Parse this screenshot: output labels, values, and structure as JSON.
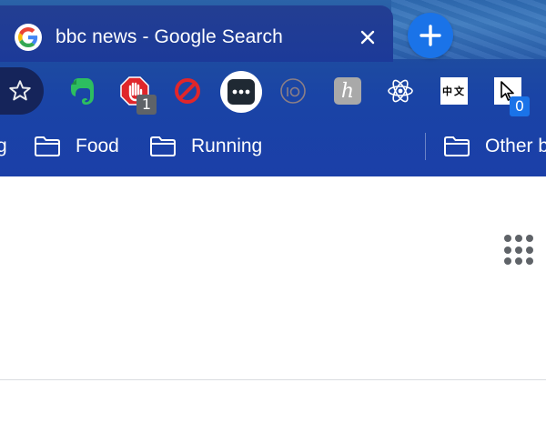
{
  "tab": {
    "title": "bbc news - Google Search",
    "favicon_icon": "google-g-icon",
    "close_icon": "close-icon"
  },
  "new_tab": {
    "icon": "plus-icon"
  },
  "toolbar": {
    "bookmark_star_icon": "star-outline-icon",
    "extensions": [
      {
        "name": "evernote",
        "icon": "evernote-elephant-icon"
      },
      {
        "name": "adblock",
        "icon": "stop-hand-icon",
        "badge": "1"
      },
      {
        "name": "blocker",
        "icon": "no-entry-icon"
      },
      {
        "name": "password-manager",
        "icon": "dots-pill-icon"
      },
      {
        "name": "io-extension",
        "icon": "io-circle-icon"
      },
      {
        "name": "h-extension",
        "icon": "h-tile-icon"
      },
      {
        "name": "react-devtools",
        "icon": "react-atom-icon"
      },
      {
        "name": "chinese-tool",
        "icon": "chinese-chars-icon",
        "label": "中文"
      },
      {
        "name": "cursor-extension",
        "icon": "cursor-arrow-icon",
        "badge": "0"
      }
    ]
  },
  "bookmarks": {
    "partial_left": "g",
    "items": [
      {
        "label": "Food"
      },
      {
        "label": "Running"
      }
    ],
    "other": "Other b"
  },
  "content": {
    "apps_icon": "apps-grid-icon"
  },
  "colors": {
    "frame": "#1b3fa8",
    "new_tab": "#1a73e8",
    "adblock_red": "#e0262b",
    "evernote_green": "#2dbe60",
    "cursor_badge": "#1a73e8"
  }
}
